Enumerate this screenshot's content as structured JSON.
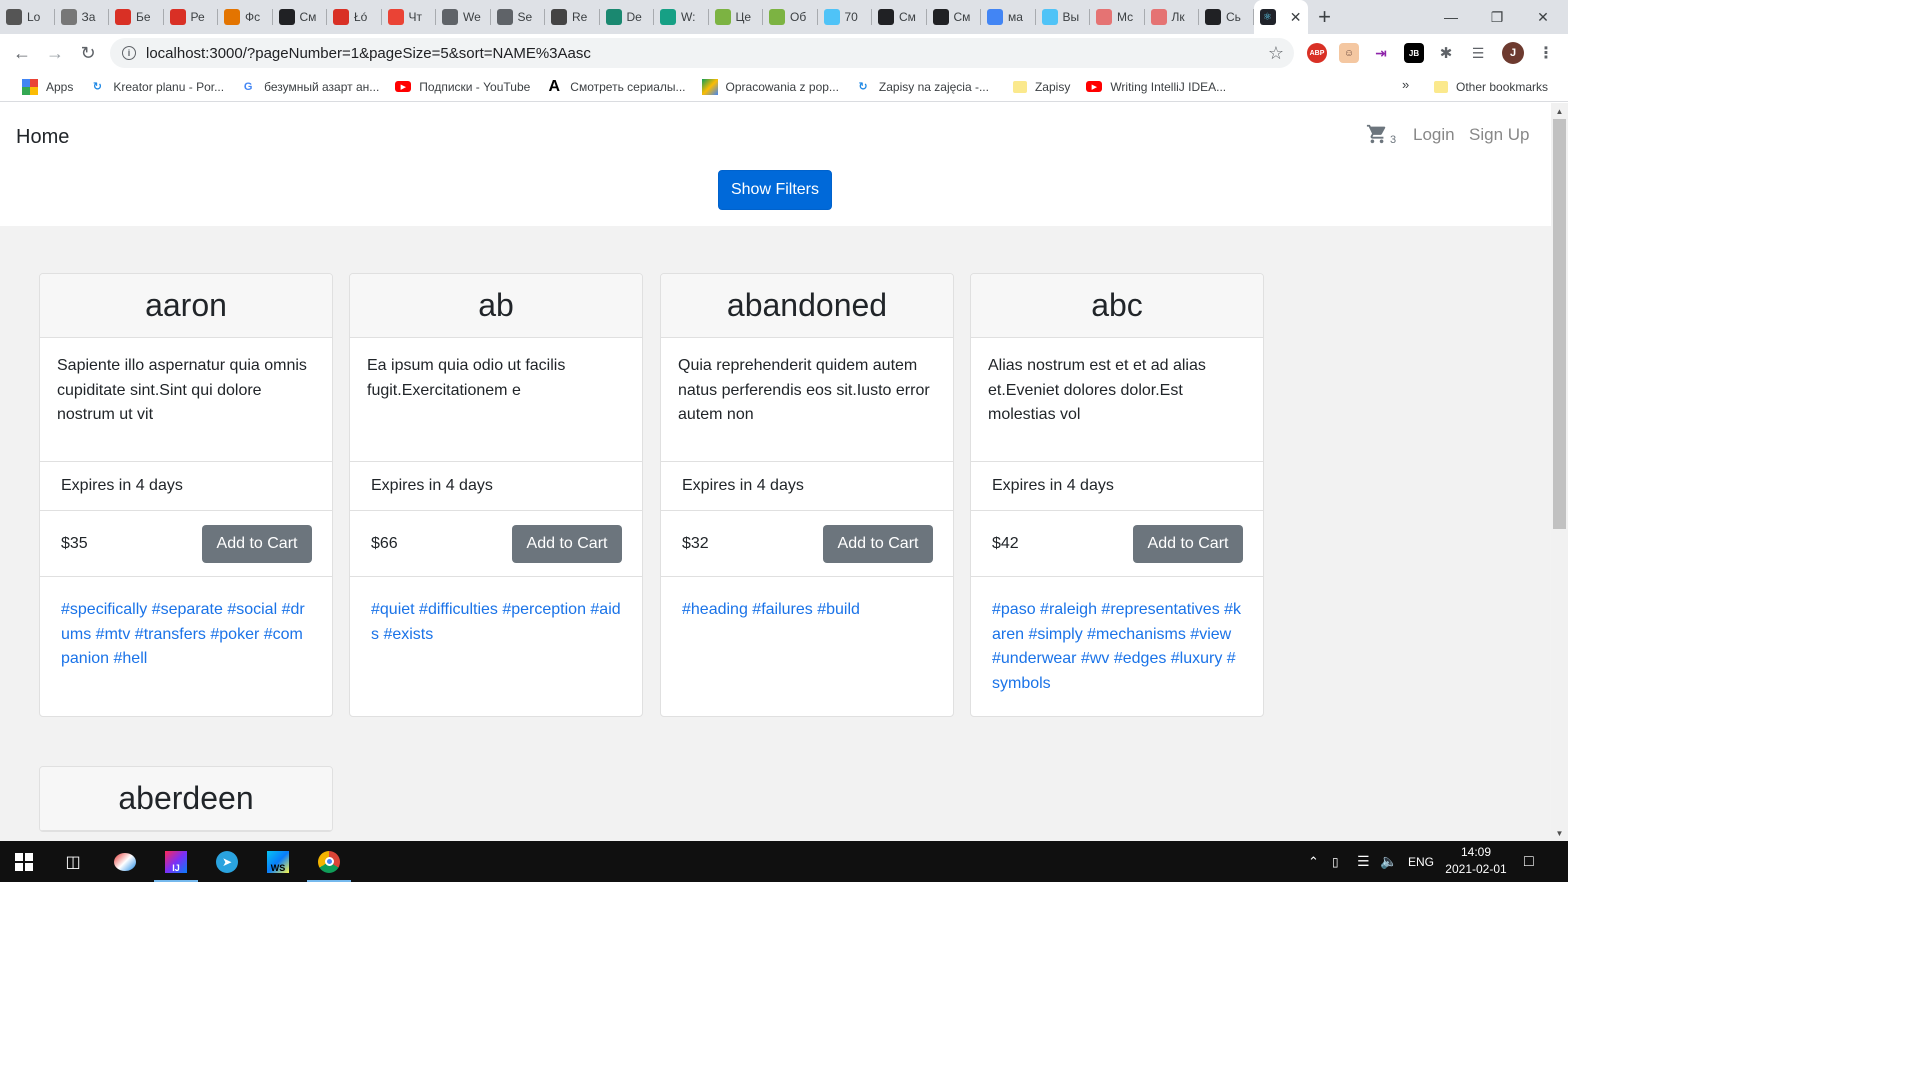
{
  "browser": {
    "tabs": [
      {
        "label": "Lo",
        "icon": "gh-icon",
        "color": "#555"
      },
      {
        "label": "За",
        "icon": "avatar-icon",
        "color": "#777"
      },
      {
        "label": "Бе",
        "icon": "tur-icon",
        "color": "#d93025"
      },
      {
        "label": "Ре",
        "icon": "tur-icon",
        "color": "#d93025"
      },
      {
        "label": "Фс",
        "icon": "pinwheel-icon",
        "color": "#e37400"
      },
      {
        "label": "См",
        "icon": "hd-icon",
        "color": "#202124"
      },
      {
        "label": "Łó",
        "icon": "pl-icon",
        "color": "#d93025"
      },
      {
        "label": "Чт",
        "icon": "arrow-icon",
        "color": "#ea4335"
      },
      {
        "label": "We",
        "icon": "k-icon",
        "color": "#5f6368"
      },
      {
        "label": "Se",
        "icon": "io-icon",
        "color": "#5f6368"
      },
      {
        "label": "Re",
        "icon": "rec-icon",
        "color": "#444"
      },
      {
        "label": "De",
        "icon": "react-icon",
        "color": "#1a8870"
      },
      {
        "label": "W:",
        "icon": "w-icon",
        "color": "#16a085"
      },
      {
        "label": "Це",
        "icon": "coin-icon",
        "color": "#7cb342"
      },
      {
        "label": "Об",
        "icon": "coin-icon",
        "color": "#7cb342"
      },
      {
        "label": "70",
        "icon": "snow-icon",
        "color": "#4fc3f7"
      },
      {
        "label": "См",
        "icon": "hd-icon",
        "color": "#202124"
      },
      {
        "label": "См",
        "icon": "hd-icon",
        "color": "#202124"
      },
      {
        "label": "ма",
        "icon": "google-icon",
        "color": "#4285f4"
      },
      {
        "label": "Вы",
        "icon": "snow-icon",
        "color": "#4fc3f7"
      },
      {
        "label": "Мс",
        "icon": "t-icon",
        "color": "#e57373"
      },
      {
        "label": "Лк",
        "icon": "t-icon",
        "color": "#e57373"
      },
      {
        "label": "Сь",
        "icon": "lf-icon",
        "color": "#202124"
      }
    ],
    "active_tab_icon": "react-icon",
    "url": "localhost:3000/?pageNumber=1&pageSize=5&sort=NAME%3Aasc",
    "profile_initial": "J",
    "bookmarks": [
      {
        "label": "Apps",
        "icon": "apps-grid-icon"
      },
      {
        "label": "Kreator planu - Por...",
        "icon": "loop-icon"
      },
      {
        "label": "безумный азарт ан...",
        "icon": "google-icon"
      },
      {
        "label": "Подписки - YouTube",
        "icon": "youtube-icon"
      },
      {
        "label": "Смотреть сериалы...",
        "icon": "a-icon"
      },
      {
        "label": "Opracowania z pop...",
        "icon": "drive-icon"
      },
      {
        "label": "Zapisy na zajęcia -...",
        "icon": "loop-icon"
      },
      {
        "label": "Zapisy",
        "icon": "folder-icon"
      },
      {
        "label": "Writing IntelliJ IDEA...",
        "icon": "youtube-icon"
      }
    ],
    "overflow": "»",
    "other_bookmarks": "Other bookmarks"
  },
  "page": {
    "brand": "Home",
    "cart_count": "3",
    "login": "Login",
    "signup": "Sign Up",
    "show_filters": "Show Filters",
    "add_to_cart": "Add to Cart",
    "cards": [
      {
        "title": "aaron",
        "description": "Sapiente illo aspernatur quia omnis cupiditate sint.Sint qui dolore nostrum ut vit",
        "expires": "Expires in 4 days",
        "price": "$35",
        "tags": "#specifically #separate #social #drums #mtv #transfers #poker #companion #hell"
      },
      {
        "title": "ab",
        "description": "Ea ipsum quia odio ut facilis fugit.Exercitationem e",
        "expires": "Expires in 4 days",
        "price": "$66",
        "tags": "#quiet #difficulties #perception #aids #exists"
      },
      {
        "title": "abandoned",
        "description": "Quia reprehenderit quidem autem natus perferendis eos sit.Iusto error autem non",
        "expires": "Expires in 4 days",
        "price": "$32",
        "tags": "#heading #failures #build"
      },
      {
        "title": "abc",
        "description": "Alias nostrum est et et ad alias et.Eveniet dolores dolor.Est molestias vol",
        "expires": "Expires in 4 days",
        "price": "$42",
        "tags": "#paso #raleigh #representatives #karen #simply #mechanisms #view #underwear #wv #edges #luxury #symbols"
      },
      {
        "title": "aberdeen"
      }
    ]
  },
  "taskbar": {
    "language": "ENG",
    "time": "14:09",
    "date": "2021-02-01"
  },
  "colors": {
    "primary": "#0069d9",
    "secondary_btn": "#6c757d",
    "tag_link": "#1a73e8"
  }
}
